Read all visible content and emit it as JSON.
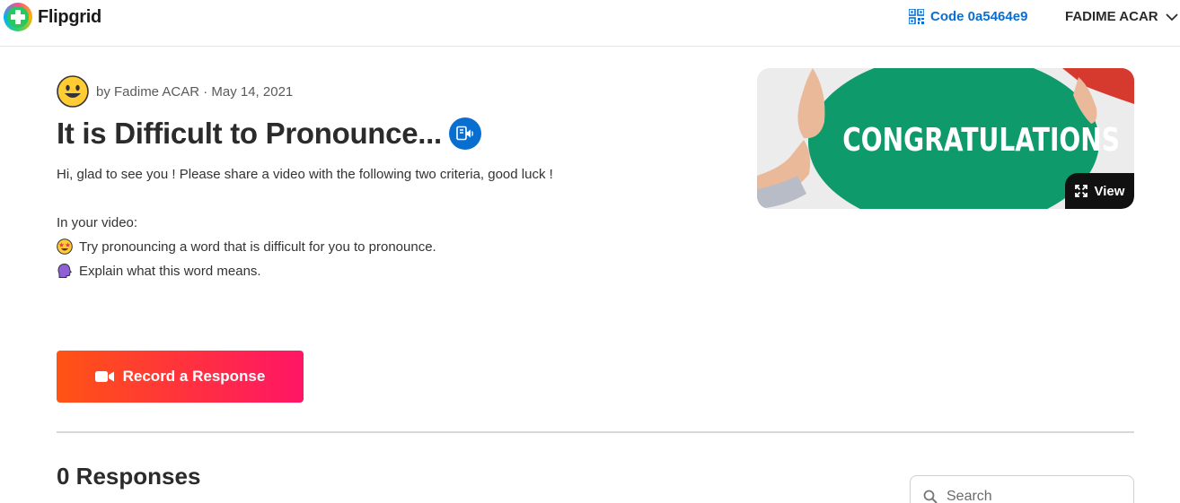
{
  "header": {
    "brand": "Flipgrid",
    "code_label": "Code 0a5464e9",
    "user_name": "FADIME ACAR"
  },
  "topic": {
    "author_line": "by Fadime ACAR · May 14, 2021",
    "title": "It is Difficult to Pronounce...",
    "intro": "Hi, glad to see you ! Please share a video with the following two criteria, good luck !",
    "criteria_heading": "In your video:",
    "criteria": [
      {
        "icon": "star-struck-emoji-icon",
        "text": "Try pronouncing a word that is difficult for you to pronounce."
      },
      {
        "icon": "speaking-head-emoji-icon",
        "text": "Explain what this word means."
      }
    ]
  },
  "media": {
    "image_text": "CONGRATULATIONS",
    "view_label": "View"
  },
  "actions": {
    "record_label": "Record a Response"
  },
  "responses": {
    "heading": "0 Responses",
    "search_placeholder": "Search"
  },
  "colors": {
    "brand_blue": "#0a6ed1",
    "record_gradient_start": "#ff5414",
    "record_gradient_end": "#ff1566",
    "card_green": "#0e9a6a"
  }
}
